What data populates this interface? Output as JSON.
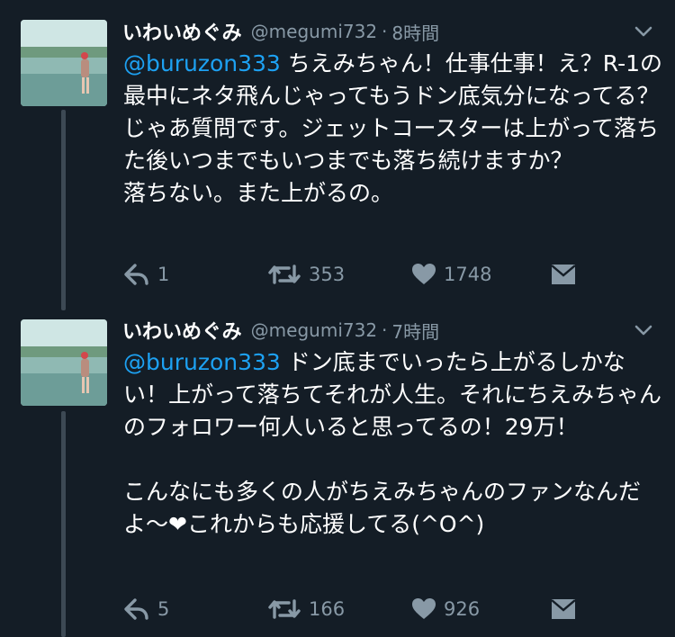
{
  "colors": {
    "background": "#141d26",
    "mention": "#1da1f2",
    "secondary_text": "#8899a6",
    "thread_line": "#3d4954"
  },
  "tweets": [
    {
      "display_name": "いわいめぐみ",
      "handle": "@megumi732",
      "separator": "·",
      "time": "8時間",
      "mention": "@buruzon333",
      "text": " ちえみちゃん！仕事仕事！え？R-1の最中にネタ飛んじゃってもうドン底気分になってる？じゃあ質問です。ジェットコースターは上がって落ちた後いつまでもいつまでも落ち続けますか？\n落ちない。また上がるの。",
      "replies": "1",
      "retweets": "353",
      "likes": "1748",
      "icons": [
        "reply-icon",
        "retweet-icon",
        "heart-icon",
        "direct-message-icon",
        "caret-down-icon"
      ]
    },
    {
      "display_name": "いわいめぐみ",
      "handle": "@megumi732",
      "separator": "·",
      "time": "7時間",
      "mention": "@buruzon333",
      "text": " ドン底までいったら上がるしかない！上がって落ちてそれが人生。それにちえみちゃんのフォロワー何人いると思ってるの！29万！\n\nこんなにも多くの人がちえみちゃんのファンなんだよ〜❤︎これからも応援してる(^O^)",
      "replies": "5",
      "retweets": "166",
      "likes": "926",
      "icons": [
        "reply-icon",
        "retweet-icon",
        "heart-icon",
        "direct-message-icon",
        "caret-down-icon"
      ]
    }
  ]
}
